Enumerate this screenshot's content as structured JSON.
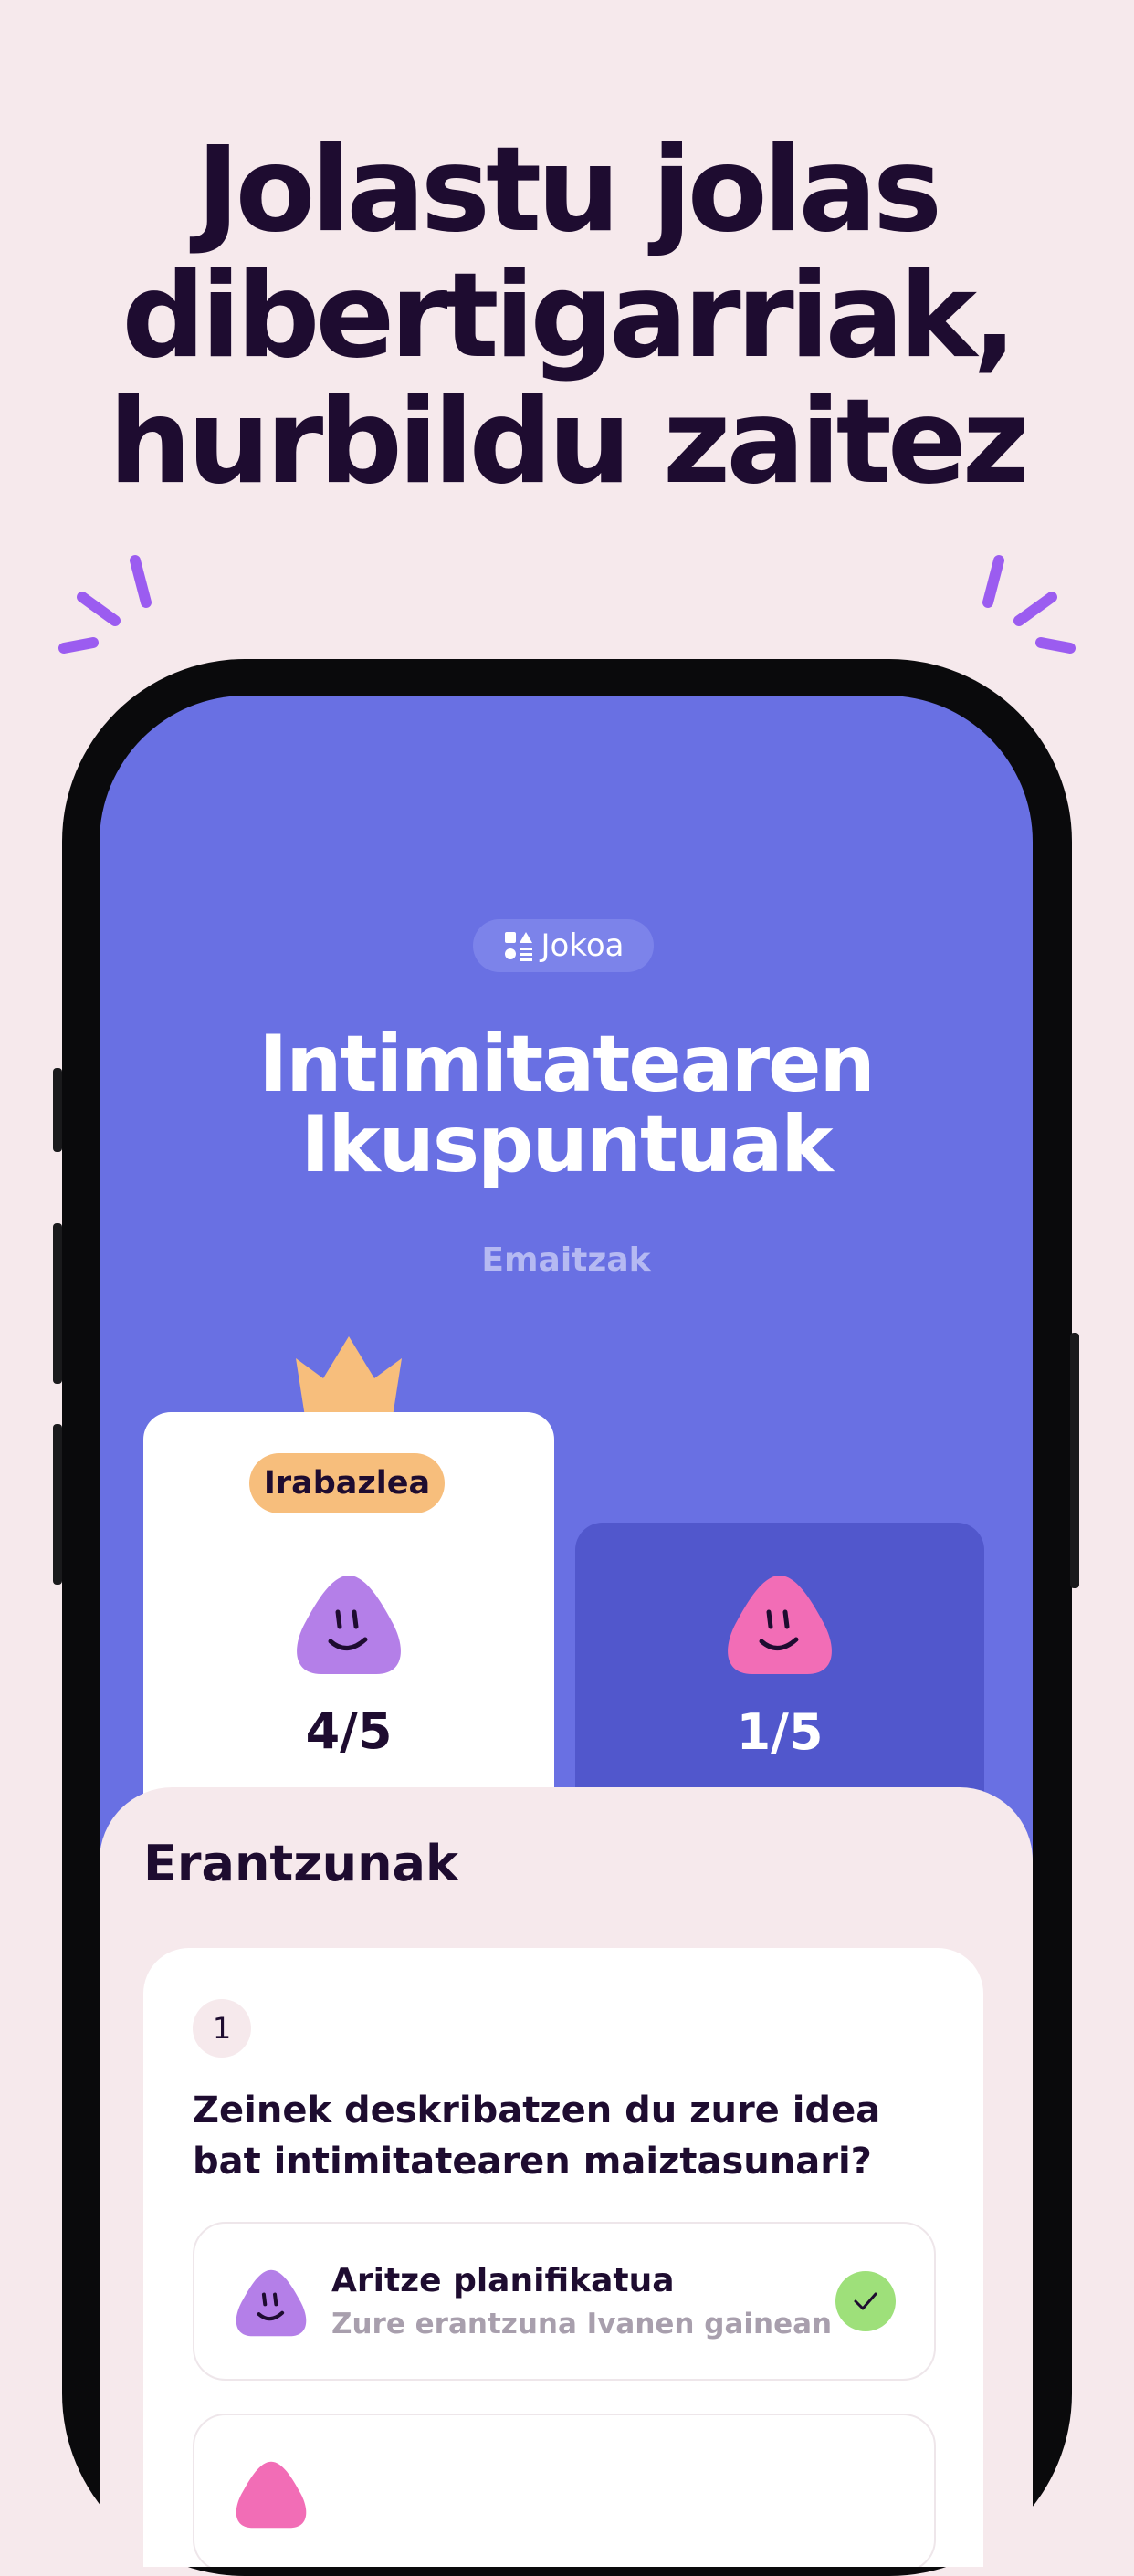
{
  "headline": {
    "line1": "Jolastu jolas",
    "line2": "dibertigarriak,",
    "line3": "hurbildu zaitez"
  },
  "app": {
    "chip": {
      "icon": "shapes-icon",
      "label": "Jokoa"
    },
    "title": {
      "line1": "Intimitatearen",
      "line2": "Ikuspuntuak"
    },
    "results_label": "Emaitzak",
    "players": [
      {
        "badge": "Irabazlea",
        "score": "4/5",
        "avatar_color": "#B47FE8",
        "card_color": "#FFFFFF",
        "score_color": "#1E0C30"
      },
      {
        "score": "1/5",
        "avatar_color": "#F26DB6",
        "card_color": "#5157CC",
        "score_color": "#FFFFFF"
      }
    ],
    "answers_section": {
      "title": "Erantzunak",
      "question": {
        "number": "1",
        "text": "Zeinek deskribatzen du zure idea bat intimitatearen maiztasunari?",
        "answers": [
          {
            "title": "Aritze planifikatua",
            "subtitle": "Zure erantzuna Ivanen gainean",
            "correct": true
          }
        ]
      }
    }
  },
  "colors": {
    "background": "#F6E9EC",
    "screen": "#6970E3",
    "accent_purple": "#9B5CF0",
    "crown": "#F7BE7C",
    "check": "#9EE07A"
  }
}
